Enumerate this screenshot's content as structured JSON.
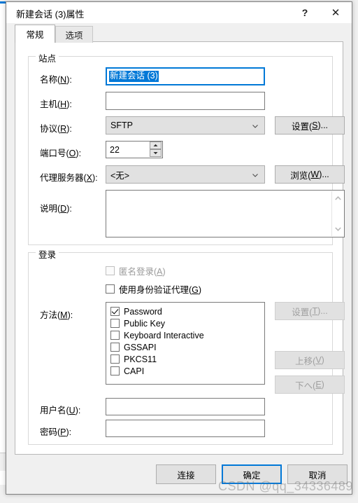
{
  "background": {
    "fragments": [
      "5,",
      "5,",
      "14",
      "26",
      "14",
      "11",
      "25",
      "4,",
      "10",
      "6,",
      "71",
      "14",
      "25",
      "6,",
      "30",
      "11"
    ]
  },
  "window": {
    "title": "新建会话 (3)属性",
    "help_glyph": "?",
    "close_glyph": "✕"
  },
  "tabs": [
    {
      "label": "常规",
      "active": true
    },
    {
      "label": "选项",
      "active": false
    }
  ],
  "site_group": {
    "title": "站点",
    "name": {
      "label": "名称(N):",
      "label_plain": "名称(",
      "mnemonic": "N",
      "label_tail": "):",
      "value": "新建会话 (3)",
      "selected": true
    },
    "host": {
      "label_plain": "主机(",
      "mnemonic": "H",
      "label_tail": "):",
      "value": "",
      "placeholder": ""
    },
    "protocol": {
      "label_plain": "协议(",
      "mnemonic": "R",
      "label_tail": "):",
      "value": "SFTP",
      "button": {
        "plain": "设置(",
        "mnemonic": "S",
        "tail": ")...",
        "enabled": true
      }
    },
    "port": {
      "label_plain": "端口号(",
      "mnemonic": "O",
      "label_tail": "):",
      "value": "22"
    },
    "proxy": {
      "label_plain": "代理服务器(",
      "mnemonic": "X",
      "label_tail": "):",
      "value": "<无>",
      "button": {
        "plain": "浏览(",
        "mnemonic": "W",
        "tail": ")...",
        "enabled": true
      }
    },
    "description": {
      "label_plain": "说明(",
      "mnemonic": "D",
      "label_tail": "):",
      "value": ""
    }
  },
  "login_group": {
    "title": "登录",
    "anonymous": {
      "plain": "匿名登录(",
      "mnemonic": "A",
      "tail": ")",
      "checked": false,
      "enabled": false
    },
    "auth_agent": {
      "plain": "使用身份验证代理(",
      "mnemonic": "G",
      "tail": ")",
      "checked": false,
      "enabled": true
    },
    "method": {
      "label_plain": "方法(",
      "mnemonic": "M",
      "label_tail": "):",
      "items": [
        {
          "label": "Password",
          "checked": true
        },
        {
          "label": "Public Key",
          "checked": false
        },
        {
          "label": "Keyboard Interactive",
          "checked": false
        },
        {
          "label": "GSSAPI",
          "checked": false
        },
        {
          "label": "PKCS11",
          "checked": false
        },
        {
          "label": "CAPI",
          "checked": false
        }
      ],
      "buttons": [
        {
          "plain": "设置(",
          "mnemonic": "T",
          "tail": ")...",
          "enabled": false
        },
        {
          "plain": "上移(",
          "mnemonic": "V",
          "tail": ")",
          "enabled": false
        },
        {
          "plain": "下へ(",
          "mnemonic": "E",
          "tail": ")",
          "enabled": false
        }
      ]
    },
    "username": {
      "label_plain": "用户名(",
      "mnemonic": "U",
      "label_tail": "):",
      "value": ""
    },
    "password": {
      "label_plain": "密码(",
      "mnemonic": "P",
      "label_tail": "):",
      "value": ""
    }
  },
  "footer": {
    "connect": "连接",
    "ok": "确定",
    "cancel": "取消"
  },
  "watermark": "CSDN @qq_34336489",
  "colors": {
    "accent": "#0078d7",
    "dialog_bg": "#f0f0f0",
    "panel_bg": "#ffffff",
    "control_bg": "#e1e1e1",
    "disabled_text": "#a0a0a0"
  }
}
